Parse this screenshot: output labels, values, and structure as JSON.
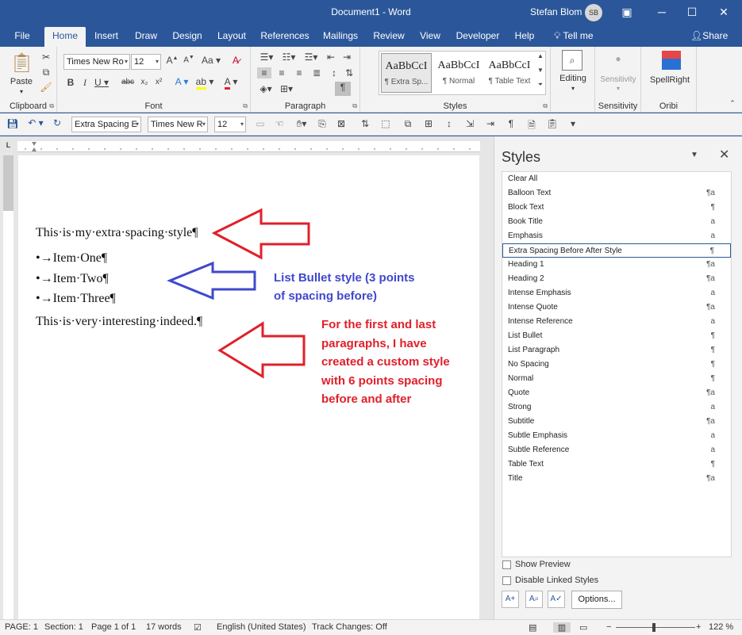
{
  "titlebar": {
    "doc_title": "Document1 - Word",
    "user": "Stefan Blom",
    "avatar_initials": "SB"
  },
  "tabs": [
    {
      "label": "File"
    },
    {
      "label": "Home"
    },
    {
      "label": "Insert"
    },
    {
      "label": "Draw"
    },
    {
      "label": "Design"
    },
    {
      "label": "Layout"
    },
    {
      "label": "References"
    },
    {
      "label": "Mailings"
    },
    {
      "label": "Review"
    },
    {
      "label": "View"
    },
    {
      "label": "Developer"
    },
    {
      "label": "Help"
    }
  ],
  "tell_me": "Tell me",
  "share": "Share",
  "ribbon": {
    "clipboard": {
      "paste": "Paste",
      "label": "Clipboard"
    },
    "font": {
      "name": "Times New Ro",
      "size": "12",
      "label": "Font"
    },
    "paragraph": {
      "label": "Paragraph"
    },
    "styles": {
      "label": "Styles",
      "items": [
        {
          "sample": "AaBbCcI",
          "name": "¶ Extra Sp..."
        },
        {
          "sample": "AaBbCcI",
          "name": "¶ Normal"
        },
        {
          "sample": "AaBbCcI",
          "name": "¶ Table Text"
        }
      ]
    },
    "editing": {
      "label": "Editing"
    },
    "sensitivity": {
      "button": "Sensitivity",
      "label": "Sensitivity"
    },
    "oribi": {
      "button": "SpellRight",
      "label": "Oribi"
    }
  },
  "qat": {
    "style": "Extra Spacing E",
    "font": "Times New R",
    "size": "12"
  },
  "document": {
    "para1": "This·is·my·extra·spacing·style¶",
    "bullets": [
      "•→Item·One¶",
      "•→Item·Two¶",
      "•→Item·Three¶"
    ],
    "para2": "This·is·very·interesting·indeed.¶",
    "note_blue": [
      "List Bullet style (3 points",
      "of spacing before)"
    ],
    "note_red": [
      "For the first and last",
      "paragraphs, I have",
      "created a custom style",
      "with 6 points spacing",
      "before and after"
    ]
  },
  "styles_pane": {
    "title": "Styles",
    "items": [
      {
        "name": "Clear All",
        "type": ""
      },
      {
        "name": "Balloon Text",
        "type": "¶a"
      },
      {
        "name": "Block Text",
        "type": "¶"
      },
      {
        "name": "Book Title",
        "type": "a"
      },
      {
        "name": "Emphasis",
        "type": "a"
      },
      {
        "name": "Extra Spacing Before After Style",
        "type": "¶"
      },
      {
        "name": "Heading 1",
        "type": "¶a"
      },
      {
        "name": "Heading 2",
        "type": "¶a"
      },
      {
        "name": "Intense Emphasis",
        "type": "a"
      },
      {
        "name": "Intense Quote",
        "type": "¶a"
      },
      {
        "name": "Intense Reference",
        "type": "a"
      },
      {
        "name": "List Bullet",
        "type": "¶"
      },
      {
        "name": "List Paragraph",
        "type": "¶"
      },
      {
        "name": "No Spacing",
        "type": "¶"
      },
      {
        "name": "Normal",
        "type": "¶"
      },
      {
        "name": "Quote",
        "type": "¶a"
      },
      {
        "name": "Strong",
        "type": "a"
      },
      {
        "name": "Subtitle",
        "type": "¶a"
      },
      {
        "name": "Subtle Emphasis",
        "type": "a"
      },
      {
        "name": "Subtle Reference",
        "type": "a"
      },
      {
        "name": "Table Text",
        "type": "¶"
      },
      {
        "name": "Title",
        "type": "¶a"
      }
    ],
    "selected_index": 5,
    "show_preview": "Show Preview",
    "disable_linked": "Disable Linked Styles",
    "options": "Options..."
  },
  "status": {
    "page": "PAGE: 1",
    "section": "Section: 1",
    "page_of": "Page 1 of 1",
    "words": "17 words",
    "language": "English (United States)",
    "track": "Track Changes: Off",
    "zoom": "122 %"
  },
  "colors": {
    "accent": "#2b579a",
    "arrow_red": "#e0202a",
    "arrow_blue": "#3f48cc"
  }
}
